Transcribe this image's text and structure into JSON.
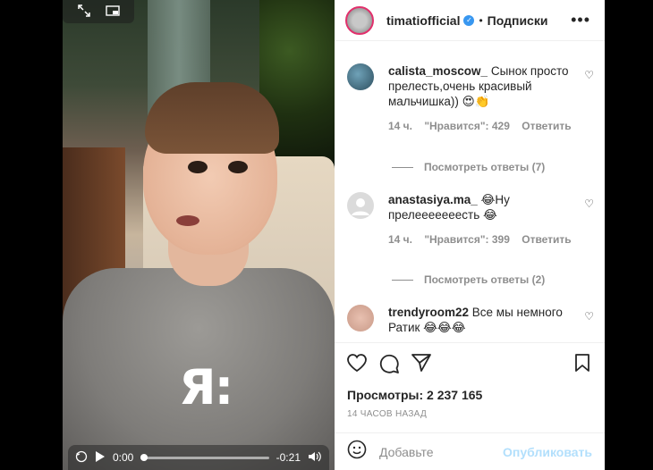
{
  "header": {
    "username": "timatiofficial",
    "verified_mark": "✓",
    "separator": "•",
    "follow_label": "Подписки",
    "more_label": "•••"
  },
  "video": {
    "logo_text": "Я:",
    "current_time": "0:00",
    "remaining_time": "-0:21",
    "progress": 0,
    "icons": [
      "expand-icon",
      "pip-icon",
      "rewind-icon",
      "play-icon",
      "volume-icon"
    ]
  },
  "comments": [
    {
      "username": "calista_moscow_",
      "text": "Сынок просто прелесть,очень красивый мальчишка)) 😍👏",
      "time": "14 ч.",
      "likes": "\"Нравится\": 429",
      "reply": "Ответить",
      "view_replies": "Посмотреть ответы (7)"
    },
    {
      "username": "anastasiya.ma_",
      "text": "😂Ну прелееееееесть 😂",
      "time": "14 ч.",
      "likes": "\"Нравится\": 399",
      "reply": "Ответить",
      "view_replies": "Посмотреть ответы (2)"
    },
    {
      "username": "trendyroom22",
      "text": "Все мы немного Ратик 😂😂😂"
    }
  ],
  "stats": {
    "views": "Просмотры: 2 237 165",
    "posted": "14 ЧАСОВ НАЗАД"
  },
  "composer": {
    "placeholder": "Добавьте",
    "publish_label": "Опубликовать"
  },
  "colors": {
    "accent_disabled": "#b2dffc",
    "verified": "#3897f0",
    "story_ring": "#e1306c"
  }
}
